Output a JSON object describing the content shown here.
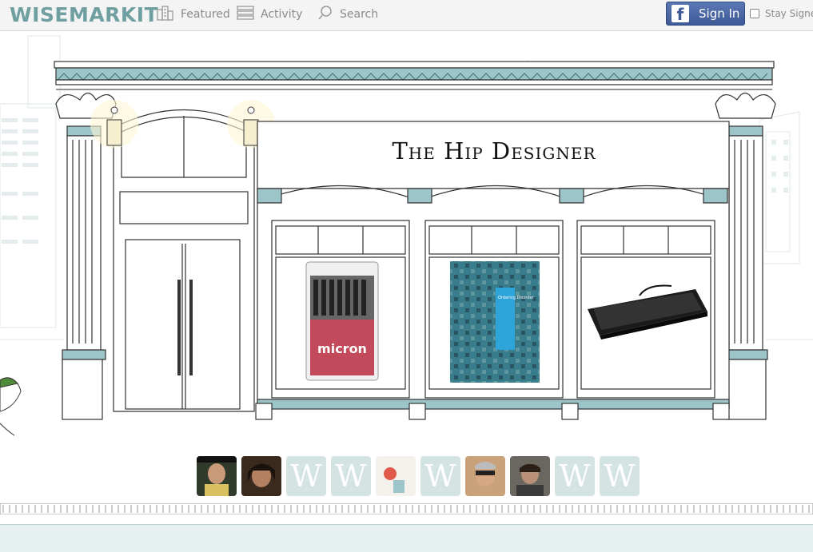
{
  "header": {
    "logo": "WISEMARKIT",
    "nav": [
      {
        "label": "Featured",
        "icon": "buildings-icon"
      },
      {
        "label": "Activity",
        "icon": "list-icon"
      },
      {
        "label": "Search",
        "icon": "magnifier-icon"
      }
    ],
    "signin_label": "Sign In",
    "stay_signed_label": "Stay Signed"
  },
  "store": {
    "name": "The Hip Designer",
    "products": [
      {
        "name": "micron pen set",
        "label": "micron"
      },
      {
        "name": "Ordering Disorder book",
        "label": "Ordering Disorder"
      },
      {
        "name": "black keyboard"
      }
    ]
  },
  "visitors": {
    "avatars": [
      {
        "type": "photo"
      },
      {
        "type": "photo"
      },
      {
        "type": "placeholder",
        "glyph": "W"
      },
      {
        "type": "placeholder",
        "glyph": "W"
      },
      {
        "type": "photo"
      },
      {
        "type": "placeholder",
        "glyph": "W"
      },
      {
        "type": "photo"
      },
      {
        "type": "photo"
      },
      {
        "type": "placeholder",
        "glyph": "W"
      },
      {
        "type": "placeholder",
        "glyph": "W"
      }
    ]
  },
  "colors": {
    "accent": "#6f9fa0",
    "facebook": "#3d5a98",
    "trim": "#8fb8be"
  }
}
